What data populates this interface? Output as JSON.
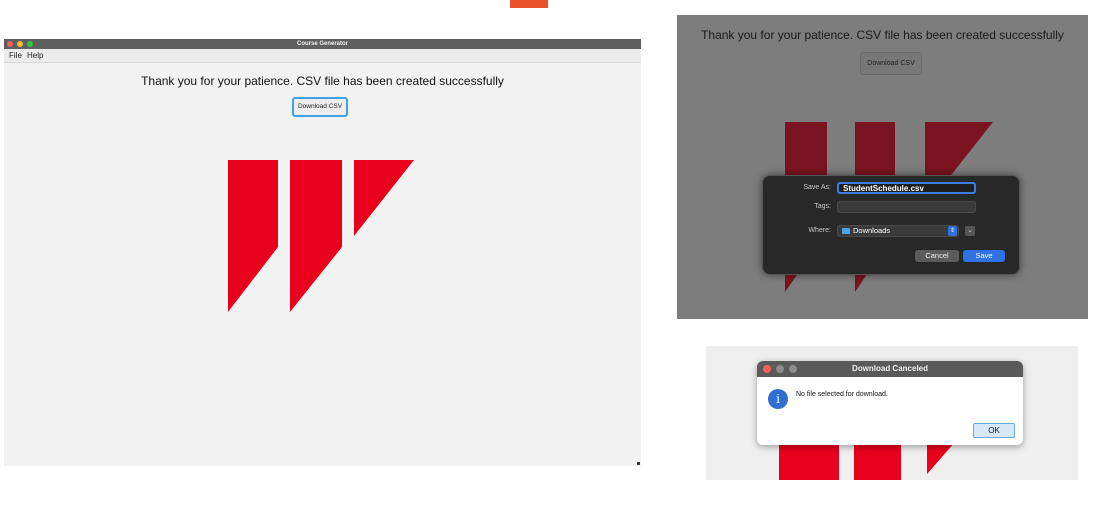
{
  "main_window": {
    "title": "Course Generator",
    "menu": [
      "File",
      "Help"
    ],
    "message": "Thank you for your patience. CSV file has been created successfully",
    "download_button": "Download CSV"
  },
  "save_dialog_panel": {
    "message": "Thank you for your patience. CSV file has been created successfully",
    "download_button": "Download CSV",
    "save_as_label": "Save As:",
    "save_as_value": "StudentSchedule.csv",
    "tags_label": "Tags:",
    "where_label": "Where:",
    "where_value": "Downloads",
    "cancel_button": "Cancel",
    "save_button": "Save"
  },
  "canceled_dialog": {
    "title": "Download Canceled",
    "message": "No file selected for download.",
    "ok_button": "OK"
  },
  "colors": {
    "logo_red": "#e8001c",
    "dim_logo_red": "#7a1420",
    "accent_orange": "#e8532b",
    "focus_blue": "#3ea2e8"
  }
}
